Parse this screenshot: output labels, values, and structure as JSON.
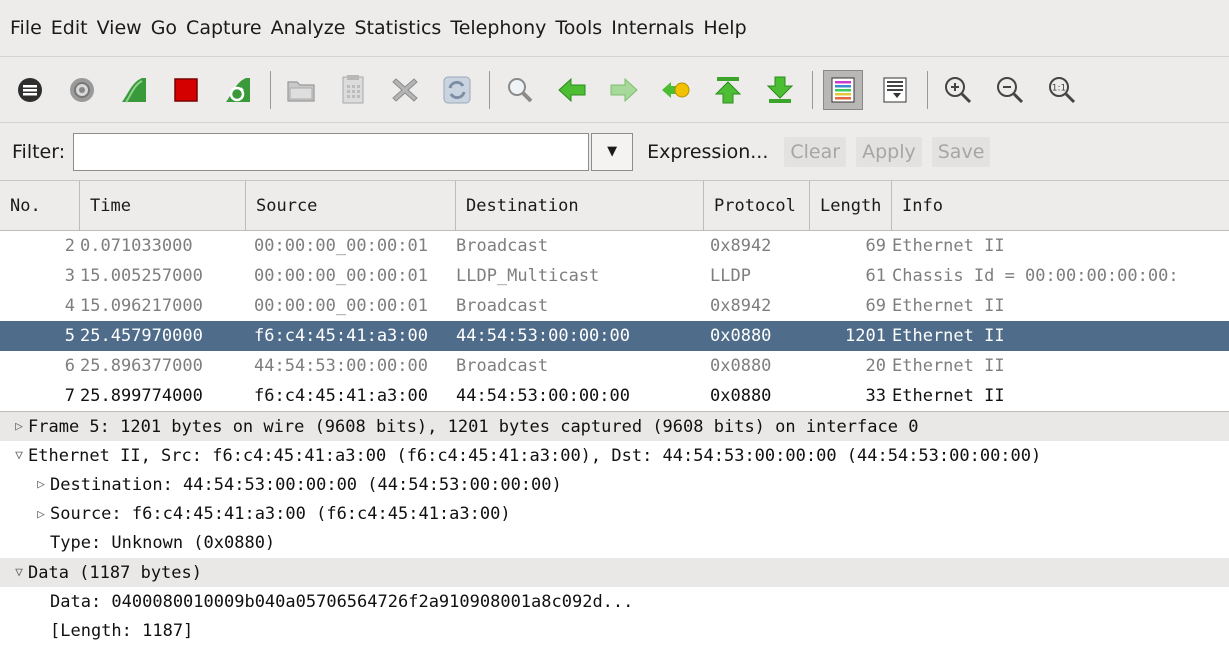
{
  "menu": [
    "File",
    "Edit",
    "View",
    "Go",
    "Capture",
    "Analyze",
    "Statistics",
    "Telephony",
    "Tools",
    "Internals",
    "Help"
  ],
  "toolbar_icons": [
    "interfaces-icon",
    "options-icon",
    "start-capture-icon",
    "stop-capture-icon",
    "restart-capture-icon",
    "open-icon",
    "save-icon",
    "close-icon",
    "reload-icon",
    "find-icon",
    "back-icon",
    "forward-icon",
    "goto-icon",
    "first-packet-icon",
    "last-packet-icon",
    "colorize-icon",
    "autoscroll-icon",
    "zoom-in-icon",
    "zoom-out-icon",
    "zoom-normal-icon"
  ],
  "filter": {
    "label": "Filter:",
    "value": "",
    "expression": "Expression...",
    "clear": "Clear",
    "apply": "Apply",
    "save": "Save"
  },
  "columns": [
    "No.",
    "Time",
    "Source",
    "Destination",
    "Protocol",
    "Length",
    "Info"
  ],
  "packets": [
    {
      "no": "2",
      "time": "0.071033000",
      "src": "00:00:00_00:00:01",
      "dst": "Broadcast",
      "proto": "0x8942",
      "len": "69",
      "info": "Ethernet II",
      "style": "gray"
    },
    {
      "no": "3",
      "time": "15.005257000",
      "src": "00:00:00_00:00:01",
      "dst": "LLDP_Multicast",
      "proto": "LLDP",
      "len": "61",
      "info": "Chassis Id = 00:00:00:00:00:",
      "style": "gray"
    },
    {
      "no": "4",
      "time": "15.096217000",
      "src": "00:00:00_00:00:01",
      "dst": "Broadcast",
      "proto": "0x8942",
      "len": "69",
      "info": "Ethernet II",
      "style": "gray"
    },
    {
      "no": "5",
      "time": "25.457970000",
      "src": "f6:c4:45:41:a3:00",
      "dst": "44:54:53:00:00:00",
      "proto": "0x0880",
      "len": "1201",
      "info": "Ethernet II",
      "style": "selected"
    },
    {
      "no": "6",
      "time": "25.896377000",
      "src": "44:54:53:00:00:00",
      "dst": "Broadcast",
      "proto": "0x0880",
      "len": "20",
      "info": "Ethernet II",
      "style": "gray"
    },
    {
      "no": "7",
      "time": "25.899774000",
      "src": "f6:c4:45:41:a3:00",
      "dst": "44:54:53:00:00:00",
      "proto": "0x0880",
      "len": "33",
      "info": "Ethernet II",
      "style": "normal"
    }
  ],
  "details": [
    {
      "indent": 0,
      "toggle": "collapsed",
      "shaded": true,
      "text": "Frame 5: 1201 bytes on wire (9608 bits), 1201 bytes captured (9608 bits) on interface 0"
    },
    {
      "indent": 0,
      "toggle": "expanded",
      "shaded": false,
      "text": "Ethernet II, Src: f6:c4:45:41:a3:00 (f6:c4:45:41:a3:00), Dst: 44:54:53:00:00:00 (44:54:53:00:00:00)"
    },
    {
      "indent": 1,
      "toggle": "collapsed",
      "shaded": false,
      "text": "Destination: 44:54:53:00:00:00 (44:54:53:00:00:00)"
    },
    {
      "indent": 1,
      "toggle": "collapsed",
      "shaded": false,
      "text": "Source: f6:c4:45:41:a3:00 (f6:c4:45:41:a3:00)"
    },
    {
      "indent": 1,
      "toggle": "none",
      "shaded": false,
      "text": "Type: Unknown (0x0880)"
    },
    {
      "indent": 0,
      "toggle": "expanded",
      "shaded": true,
      "text": "Data (1187 bytes)"
    },
    {
      "indent": 1,
      "toggle": "none",
      "shaded": false,
      "text": "Data: 0400080010009b040a05706564726f2a910908001a8c092d..."
    },
    {
      "indent": 1,
      "toggle": "none",
      "shaded": false,
      "text": "[Length: 1187]"
    }
  ]
}
